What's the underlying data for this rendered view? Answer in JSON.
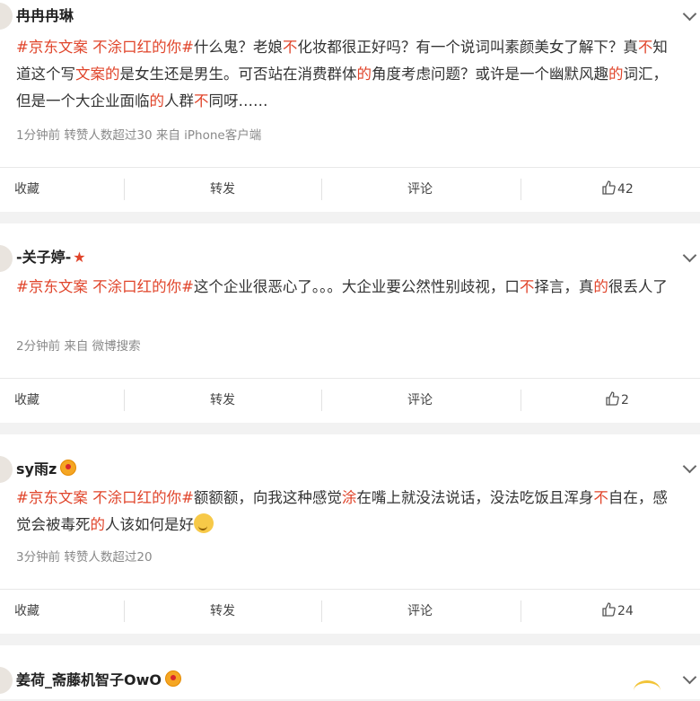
{
  "posts": [
    {
      "username": "冉冉冉琳",
      "text_segments": [
        {
          "t": "#京东文案 不涂口红的你#",
          "hl": true
        },
        {
          "t": "什么鬼？老娘",
          "hl": false
        },
        {
          "t": "不",
          "hl": true
        },
        {
          "t": "化妆都很正好吗？有一个说词叫素颜美女了解下？真",
          "hl": false
        },
        {
          "t": "不",
          "hl": true
        },
        {
          "t": "知道这个写",
          "hl": false
        },
        {
          "t": "文案的",
          "hl": true
        },
        {
          "t": "是女生还是男生。可否站在消费群体",
          "hl": false
        },
        {
          "t": "的",
          "hl": true
        },
        {
          "t": "角度考虑问题？或许是一个幽默风趣",
          "hl": false
        },
        {
          "t": "的",
          "hl": true
        },
        {
          "t": "词汇，但是一个大企业面临",
          "hl": false
        },
        {
          "t": "的",
          "hl": true
        },
        {
          "t": "人群",
          "hl": false
        },
        {
          "t": "不",
          "hl": true
        },
        {
          "t": "同呀……",
          "hl": false
        }
      ],
      "meta": "1分钟前  转赞人数超过30 来自 iPhone客户端",
      "actions": {
        "collect": "收藏",
        "repost": "转发",
        "comment": "评论",
        "like_count": "42"
      }
    },
    {
      "username": "-关子婷-",
      "badge": "★",
      "text_segments": [
        {
          "t": "#京东文案 不涂口红的你#",
          "hl": true
        },
        {
          "t": "这个企业很恶心了。。。大企业要公然性别歧视，口",
          "hl": false
        },
        {
          "t": "不",
          "hl": true
        },
        {
          "t": "择言，真",
          "hl": false
        },
        {
          "t": "的",
          "hl": true
        },
        {
          "t": "很丢人了",
          "hl": false
        }
      ],
      "meta": "2分钟前  来自 微博搜索",
      "actions": {
        "collect": "收藏",
        "repost": "转发",
        "comment": "评论",
        "like_count": "2"
      }
    },
    {
      "username": "sy雨z",
      "text_segments": [
        {
          "t": "#京东文案 不涂口红的你#",
          "hl": true
        },
        {
          "t": "额额额，向我这种感觉",
          "hl": false
        },
        {
          "t": "涂",
          "hl": true
        },
        {
          "t": "在嘴上就没法说话，没法吃饭且浑身",
          "hl": false
        },
        {
          "t": "不",
          "hl": true
        },
        {
          "t": "自在，感觉会被毒死",
          "hl": false
        },
        {
          "t": "的",
          "hl": true
        },
        {
          "t": "人该如何是好",
          "hl": false
        }
      ],
      "meta": "3分钟前  转赞人数超过20",
      "actions": {
        "collect": "收藏",
        "repost": "转发",
        "comment": "评论",
        "like_count": "24"
      }
    },
    {
      "username": "姜荷_斋藤机智子OwO"
    }
  ],
  "colors": {
    "highlight": "#e0442a",
    "meta": "#8a8a8a",
    "background": "#f2f2f2"
  },
  "icons": [
    "chevron-down-icon",
    "thumb-up-icon",
    "crown-badge-icon",
    "star-badge-icon"
  ]
}
